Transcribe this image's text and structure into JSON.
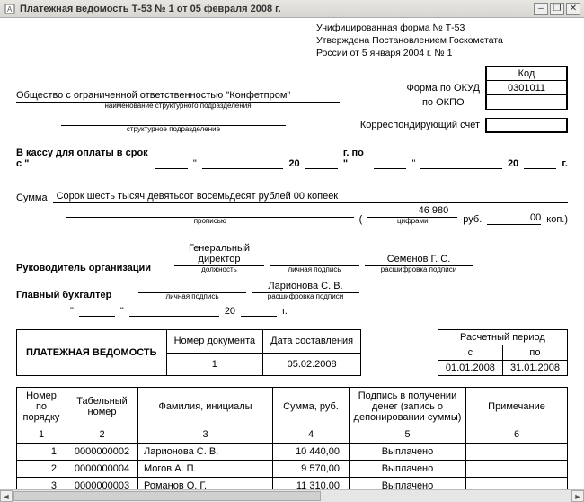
{
  "window": {
    "title": "Платежная ведомость Т-53  № 1 от 05 февраля 2008 г."
  },
  "form_header": {
    "l1": "Унифицированная форма № Т-53",
    "l2": "Утверждена Постановлением Госкомстата",
    "l3": "России от 5 января 2004 г. № 1"
  },
  "codes": {
    "kod_label": "Код",
    "okud_label": "Форма по ОКУД",
    "okud_value": "0301011",
    "okpo_label": "по ОКПО",
    "okpo_value": "",
    "corr_label": "Корреспондирующий счет",
    "corr_value": ""
  },
  "org": {
    "name": "Общество с ограниченной ответственностью \"Конфетпром\"",
    "sub1": "наименование структурного подразделения",
    "subunit": "",
    "sub2": "структурное подразделение"
  },
  "cash_period": {
    "prefix": "В кассу для оплаты в срок с \"",
    "d1": "",
    "mid1": "\"",
    "m1": "",
    "y_label": "20",
    "y_unit": "г. по \"",
    "d2": "",
    "mid2": "\"",
    "m2": "",
    "y2_label": "20",
    "y2_unit": "г."
  },
  "sum": {
    "label": "Сумма",
    "words": "Сорок шесть тысяч девятьсот восемьдесят рублей 00 копеек",
    "sub_words": "прописью",
    "open": "(",
    "rub": "46 980",
    "rub_u": "руб.",
    "kop": "00",
    "kop_u": "коп.)",
    "sub_num": "цифрами"
  },
  "signers": {
    "head_label": "Руководитель организации",
    "head_pos_top": "Генеральный",
    "head_pos_bot": "директор",
    "pos_sub": "должность",
    "sign_sub": "личная подпись",
    "head_name": "Семенов Г. С.",
    "name_sub": "расшифровка подписи",
    "acc_label": "Главный бухгалтер",
    "acc_name": "Ларионова С. В."
  },
  "date_small": {
    "q1": "\"",
    "d": "",
    "q2": "\"",
    "m": "",
    "y": "20",
    "u": "г."
  },
  "doc_box": {
    "title": "ПЛАТЕЖНАЯ ВЕДОМОСТЬ",
    "num_h": "Номер документа",
    "num_v": "1",
    "date_h": "Дата составления",
    "date_v": "05.02.2008",
    "period_h": "Расчетный период",
    "from_h": "с",
    "to_h": "по",
    "from_v": "01.01.2008",
    "to_v": "31.01.2008"
  },
  "emp_table": {
    "h_num": "Номер по порядку",
    "h_tab": "Табельный номер",
    "h_fio": "Фамилия, инициалы",
    "h_sum": "Сумма, руб.",
    "h_sign": "Подпись в получении денег (запись о депонировании суммы)",
    "h_note": "Примечание",
    "c1": "1",
    "c2": "2",
    "c3": "3",
    "c4": "4",
    "c5": "5",
    "c6": "6",
    "rows": [
      {
        "n": "1",
        "tab": "0000000002",
        "fio": "Ларионова С. В.",
        "sum": "10 440,00",
        "sign": "Выплачено",
        "note": ""
      },
      {
        "n": "2",
        "tab": "0000000004",
        "fio": "Могов А. П.",
        "sum": "9 570,00",
        "sign": "Выплачено",
        "note": ""
      },
      {
        "n": "3",
        "tab": "0000000003",
        "fio": "Романов О. Г.",
        "sum": "11 310,00",
        "sign": "Выплачено",
        "note": ""
      }
    ]
  }
}
